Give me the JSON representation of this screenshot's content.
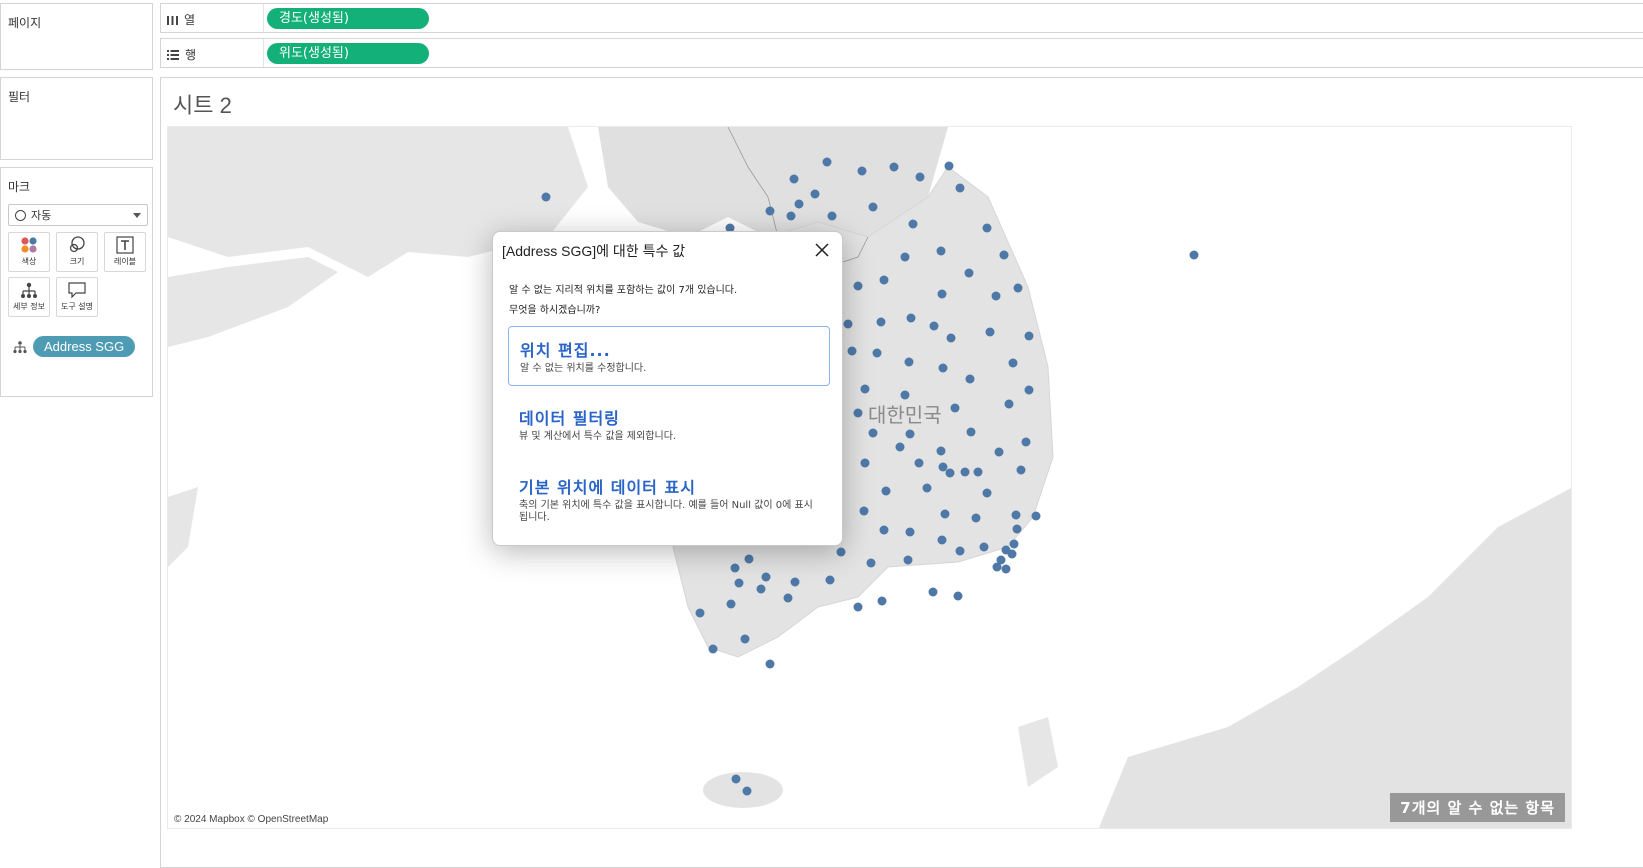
{
  "left_panel": {
    "pages_title": "페이지",
    "filters_title": "필터",
    "marks_title": "마크",
    "marks_type": "자동",
    "mark_buttons": {
      "color": "색상",
      "size": "크기",
      "label": "레이블",
      "detail": "세부 정보",
      "tooltip": "도구 설명"
    },
    "detail_pill": "Address SGG"
  },
  "shelves": {
    "columns_label": "열",
    "columns_pill": "경도(생성됨)",
    "rows_label": "행",
    "rows_pill": "위도(생성됨)"
  },
  "view": {
    "sheet_title": "시트 2",
    "map_country_label": "대한민국",
    "copyright": "© 2024 Mapbox © OpenStreetMap",
    "unknown_badge": "7개의 알 수 없는 항목"
  },
  "dialog": {
    "title": "[Address SGG]에 대한 특수 값",
    "message_line1": "알 수 없는 지리적 위치를 포함하는 값이 7개 있습니다.",
    "message_line2": "무엇을 하시겠습니까?",
    "options": [
      {
        "title": "위치 편집...",
        "desc": "알 수 없는 위치를 수정합니다."
      },
      {
        "title": "데이터 필터링",
        "desc": "뷰 및 계산에서 특수 값을 제외합니다."
      },
      {
        "title": "기본 위치에 데이터 표시",
        "desc": "축의 기본 위치에 특수 값을 표시합니다. 예를 들어 Null 값이 0에 표시됩니다."
      }
    ]
  },
  "colors": {
    "dot": "#4e79a7",
    "green_pill": "#13b079",
    "blue_pill": "#4e9bb4",
    "land": "#e3e3e3",
    "accent": "#2a64c8"
  }
}
